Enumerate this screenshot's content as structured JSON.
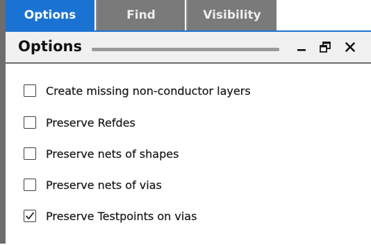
{
  "tabs": [
    {
      "label": "Options",
      "active": true
    },
    {
      "label": "Find",
      "active": false
    },
    {
      "label": "Visibility",
      "active": false
    }
  ],
  "panel": {
    "title": "Options",
    "controls": [
      "minimize-icon",
      "float-window-icon",
      "close-icon"
    ]
  },
  "options": [
    {
      "label": "Create missing non-conductor layers",
      "checked": false
    },
    {
      "label": "Preserve Refdes",
      "checked": false
    },
    {
      "label": "Preserve nets of shapes",
      "checked": false
    },
    {
      "label": "Preserve nets of vias",
      "checked": false
    },
    {
      "label": "Preserve Testpoints on vias",
      "checked": true
    }
  ],
  "colors": {
    "active_tab": "#1a73d3",
    "inactive_tab": "#7a7a7a",
    "title_bar": "#f0f0f0"
  }
}
